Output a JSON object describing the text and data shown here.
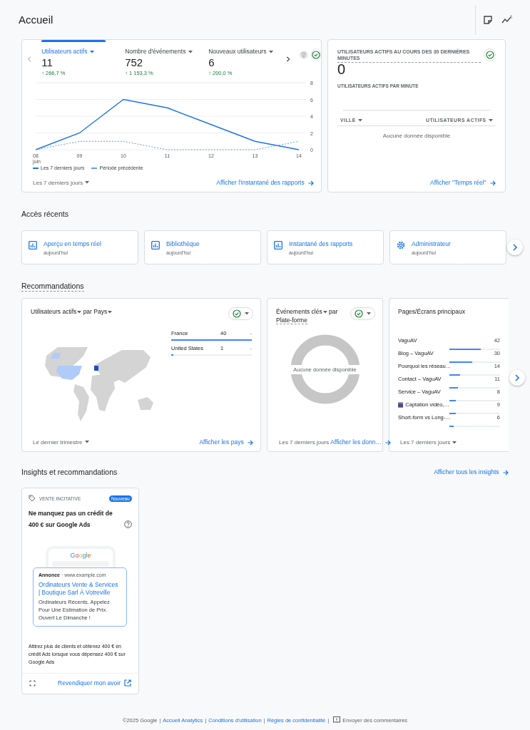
{
  "header": {
    "title": "Accueil"
  },
  "overview": {
    "tabs": [
      {
        "label": "Utilisateurs actifs",
        "value": "11",
        "change": "↑ 266,7 %",
        "selected": true
      },
      {
        "label": "Nombre d'événements",
        "value": "752",
        "change": "↑ 1 153,3 %",
        "selected": false
      },
      {
        "label": "Nouveaux utilisateurs",
        "value": "6",
        "change": "↑ 200,0 %",
        "selected": false
      }
    ],
    "chart_data": {
      "type": "line",
      "categories": [
        "08",
        "09",
        "10",
        "11",
        "12",
        "13",
        "14"
      ],
      "yticks": [
        0,
        2,
        4,
        6,
        8
      ],
      "ylim": [
        0,
        8
      ],
      "grid": true,
      "series": [
        {
          "name": "Les 7 derniers jours",
          "color": "#1a73e8",
          "line_style": "solid",
          "values": [
            0,
            2,
            6,
            5,
            3,
            1,
            0
          ]
        },
        {
          "name": "Période précédente",
          "color": "#669df6",
          "line_style": "dashed",
          "values": [
            0,
            1,
            1,
            0,
            0,
            0,
            1
          ]
        }
      ]
    },
    "month_label": "juin",
    "date_range": "Les 7 derniers jours",
    "link": "Afficher l'instantané des rapports"
  },
  "realtime": {
    "title": "UTILISATEURS ACTIFS AU COURS DES 30 DERNIÈRES MINUTES",
    "value": "0",
    "subtitle": "UTILISATEURS ACTIFS PAR MINUTE",
    "columns": [
      "VILLE",
      "UTILISATEURS ACTIFS"
    ],
    "empty": "Aucune donnée disponible",
    "link": "Afficher \"Temps réel\""
  },
  "recent": {
    "title": "Accès récents",
    "items": [
      {
        "kind": "report",
        "label": "Aperçu en temps réel",
        "time": "aujourd'hui"
      },
      {
        "kind": "report",
        "label": "Bibliothèque",
        "time": "aujourd'hui"
      },
      {
        "kind": "report",
        "label": "Instantané des rapports",
        "time": "aujourd'hui"
      },
      {
        "kind": "admin",
        "label": "Administrateur",
        "time": "aujourd'hui"
      }
    ]
  },
  "recommendations": {
    "title": "Recommandations",
    "countries": {
      "metric": "Utilisateurs actifs",
      "by": "par",
      "dimension": "Pays",
      "rows": [
        {
          "name": "France",
          "value": "40",
          "delta": "-",
          "level": 1
        },
        {
          "name": "United States",
          "value": "1",
          "delta": "-",
          "level": 0.03
        }
      ],
      "date_range": "Le dernier trimestre",
      "link": "Afficher les pays"
    },
    "platform": {
      "metric": "Événements clés",
      "by": "par",
      "dimension": "Plate-forme",
      "empty": "Aucune donnée disponible",
      "date_range": "Les 7 derniers jours",
      "link": "Afficher les donn…"
    },
    "pages": {
      "title": "Pages/Écrans principaux",
      "rows": [
        {
          "kind": "page",
          "name": "VaguAV",
          "value": "42",
          "level": 0.62
        },
        {
          "kind": "page",
          "name": "Blog – VaguAV",
          "value": "30",
          "level": 0.45
        },
        {
          "kind": "page",
          "name": "Pourquoi les réseau…",
          "value": "14",
          "level": 0.21
        },
        {
          "kind": "page",
          "name": "Contact – VaguAV",
          "value": "11",
          "level": 0.17
        },
        {
          "kind": "page",
          "name": "Service – VaguAV",
          "value": "8",
          "level": 0.12
        },
        {
          "kind": "video",
          "name": "Captation vidéo,…",
          "value": "9",
          "level": 0.13
        },
        {
          "kind": "page",
          "name": "Short-form vs Long-…",
          "value": "6",
          "level": 0.09
        }
      ],
      "date_range": "Les 7 derniers jours"
    }
  },
  "insights": {
    "title": "Insights et recommandations",
    "link": "Afficher tous les insights",
    "cards": [
      {
        "category": "VENTE INCITATIVE",
        "badge": "Nouveau",
        "headline": "Ne manquez pas un crédit de 400 € sur Google Ads",
        "logo": "Google",
        "ad_label": "Annonce",
        "ad_url": "· www.example.com",
        "ad_title": "Ordinateurs Vente & Services | Boutique Sarl À Votreville",
        "ad_body": "Ordinateurs Récents. Appelez Pour Une Estimation de Prix. Ouvert Le Dimanche !",
        "description": "Attirez plus de clients et obtenez 400 € en crédit Ads lorsque vous dépensez 400 € sur Google Ads",
        "action": "Revendiquer mon avoir"
      }
    ]
  },
  "footer": [
    {
      "kind": "text",
      "text": "©2025 Google"
    },
    {
      "kind": "sep",
      "text": "|"
    },
    {
      "kind": "link",
      "text": "Accueil Analytics"
    },
    {
      "kind": "sep",
      "text": "|"
    },
    {
      "kind": "link",
      "text": "Conditions d'utilisation"
    },
    {
      "kind": "sep",
      "text": "|"
    },
    {
      "kind": "link",
      "text": "Règles de confidentialité"
    },
    {
      "kind": "sep",
      "text": "|"
    },
    {
      "kind": "feedback",
      "text": "Envoyer des commentaires"
    }
  ]
}
